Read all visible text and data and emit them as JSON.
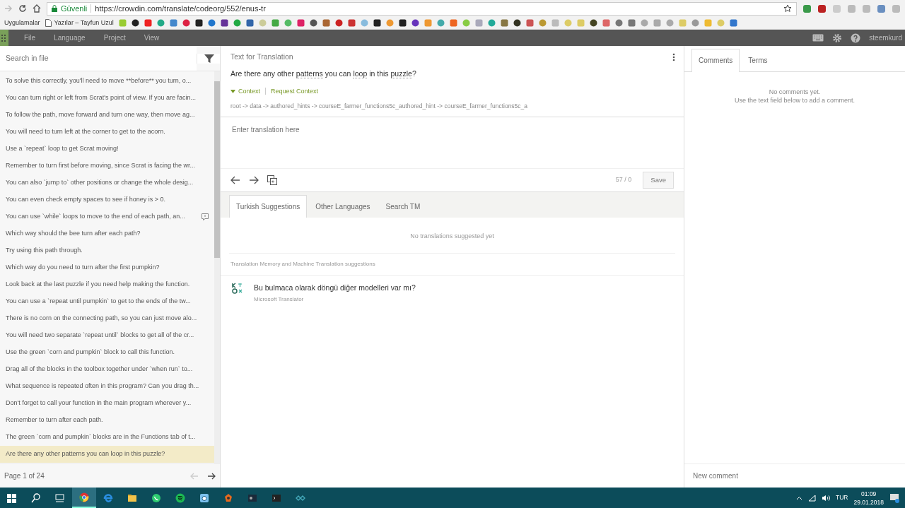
{
  "browser": {
    "secure_label": "Güvenli",
    "url": "https://crowdin.com/translate/codeorg/552/enus-tr",
    "bookmarks": [
      "Uygulamalar",
      "Yazılar – Tayfun Uzul"
    ]
  },
  "menu": {
    "items": [
      "File",
      "Language",
      "Project",
      "View"
    ],
    "user": "steemkurd"
  },
  "sidebar": {
    "search": {
      "placeholder": "Search in file"
    },
    "items": [
      {
        "text": "To solve this correctly, you'll need to move **before** you turn, o...",
        "selected": false,
        "has_comment": false
      },
      {
        "text": "You can turn right or left from Scrat's point of view. If you are facin...",
        "selected": false,
        "has_comment": false
      },
      {
        "text": "To follow the path, move forward and turn one way, then move ag...",
        "selected": false,
        "has_comment": false
      },
      {
        "text": "You will need to turn left at the corner to get to the acorn.",
        "selected": false,
        "has_comment": false
      },
      {
        "text": "Use a `repeat` loop to get Scrat moving!",
        "selected": false,
        "has_comment": false
      },
      {
        "text": "Remember to turn first before moving, since Scrat is facing the wr...",
        "selected": false,
        "has_comment": false
      },
      {
        "text": "You can also `jump to` other positions or change the whole desig...",
        "selected": false,
        "has_comment": false
      },
      {
        "text": "You can even check empty spaces to see if honey is > 0.",
        "selected": false,
        "has_comment": false
      },
      {
        "text": "You can use `while` loops to move to the end of each path, an...",
        "selected": false,
        "has_comment": true
      },
      {
        "text": "Which way should the bee turn after each path?",
        "selected": false,
        "has_comment": false
      },
      {
        "text": "Try using this path through.",
        "selected": false,
        "has_comment": false
      },
      {
        "text": "Which way do you need to turn after the first pumpkin?",
        "selected": false,
        "has_comment": false
      },
      {
        "text": "Look back at the last puzzle if you need help making the function.",
        "selected": false,
        "has_comment": false
      },
      {
        "text": "You can use a `repeat until pumpkin` to get to the ends of the tw...",
        "selected": false,
        "has_comment": false
      },
      {
        "text": "There is no corn on the connecting path, so you can just move alo...",
        "selected": false,
        "has_comment": false
      },
      {
        "text": "You will need two separate `repeat until` blocks to get all of the cr...",
        "selected": false,
        "has_comment": false
      },
      {
        "text": "Use the green `corn and pumpkin` block to call this function.",
        "selected": false,
        "has_comment": false
      },
      {
        "text": "Drag all of the blocks in the toolbox together under `when run` to...",
        "selected": false,
        "has_comment": false
      },
      {
        "text": "What sequence is repeated often in this program? Can you drag th...",
        "selected": false,
        "has_comment": false
      },
      {
        "text": "Don't forget to call your function in the main program wherever y...",
        "selected": false,
        "has_comment": false
      },
      {
        "text": "Remember to turn after each path.",
        "selected": false,
        "has_comment": false
      },
      {
        "text": "The green `corn and pumpkin` blocks are in the Functions tab of t...",
        "selected": false,
        "has_comment": false
      },
      {
        "text": "Are there any other patterns you can loop in this puzzle?",
        "selected": true,
        "has_comment": false
      }
    ],
    "pagination": "Page 1 of 24"
  },
  "source": {
    "header": "Text for Translation",
    "segments": [
      {
        "text": "Are there any other ",
        "term": false
      },
      {
        "text": "patterns",
        "term": true
      },
      {
        "text": " you can ",
        "term": false
      },
      {
        "text": "loop",
        "term": true
      },
      {
        "text": " in this ",
        "term": false
      },
      {
        "text": "puzzle",
        "term": true
      },
      {
        "text": "?",
        "term": false
      }
    ],
    "context": {
      "label": "Context",
      "expanded": true,
      "request": "Request Context",
      "path": "root -> data -> authored_hints -> courseE_farmer_functions5c_authored_hint -> courseE_farmer_functions5c_a"
    }
  },
  "editor": {
    "placeholder": "Enter translation here",
    "counter": "57 / 0",
    "save": "Save"
  },
  "suggestion_tabs": [
    {
      "label": "Turkish Suggestions",
      "selected": true
    },
    {
      "label": "Other Languages",
      "selected": false
    },
    {
      "label": "Search TM",
      "selected": false
    }
  ],
  "suggestions": {
    "empty": "No translations suggested yet",
    "section": "Translation Memory and Machine Translation suggestions",
    "items": [
      {
        "text": "Bu bulmaca olarak döngü diğer modelleri var mı?",
        "source": "Microsoft Translator"
      }
    ]
  },
  "comments": {
    "tabs": [
      {
        "label": "Comments",
        "selected": true
      },
      {
        "label": "Terms",
        "selected": false
      }
    ],
    "empty": [
      "No comments yet.",
      "Use the text field below to add a comment."
    ],
    "placeholder": "New comment"
  },
  "taskbar": {
    "language": "TUR",
    "time": "01:09",
    "date": "29.01.2018"
  }
}
